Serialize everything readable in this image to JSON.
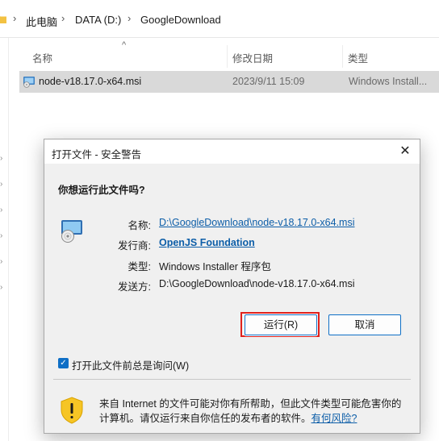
{
  "explorer": {
    "breadcrumb": [
      "此电脑",
      "DATA (D:)",
      "GoogleDownload"
    ],
    "breadcrumb_separator": "›",
    "columns": {
      "name": "名称",
      "date": "修改日期",
      "type": "类型"
    },
    "file": {
      "name": "node-v18.17.0-x64.msi",
      "date": "2023/9/11 15:09",
      "type": "Windows Install..."
    }
  },
  "dialog": {
    "title": "打开文件 - 安全警告",
    "close_glyph": "✕",
    "question": "你想运行此文件吗?",
    "fields": {
      "name_label": "名称:",
      "name_value": "D:\\GoogleDownload\\node-v18.17.0-x64.msi",
      "publisher_label": "发行商:",
      "publisher_value": "OpenJS Foundation",
      "type_label": "类型:",
      "type_value": "Windows Installer 程序包",
      "from_label": "发送方:",
      "from_value": "D:\\GoogleDownload\\node-v18.17.0-x64.msi"
    },
    "run_button": "运行(R)",
    "cancel_button": "取消",
    "checkbox_checked": true,
    "checkbox_label": "打开此文件前总是询问(W)",
    "warning_text": "来自 Internet 的文件可能对你有所帮助，但此文件类型可能危害你的计算机。请仅运行来自你信任的发布者的软件。",
    "risk_link": "有何风险?"
  },
  "colors": {
    "accent": "#0f6fc6",
    "link": "#0d5ea8",
    "highlight_outline": "#e0211c",
    "selected_row": "#d9d9d9",
    "dialog_bg": "#f0f0f0",
    "shield": "#f6c525"
  }
}
